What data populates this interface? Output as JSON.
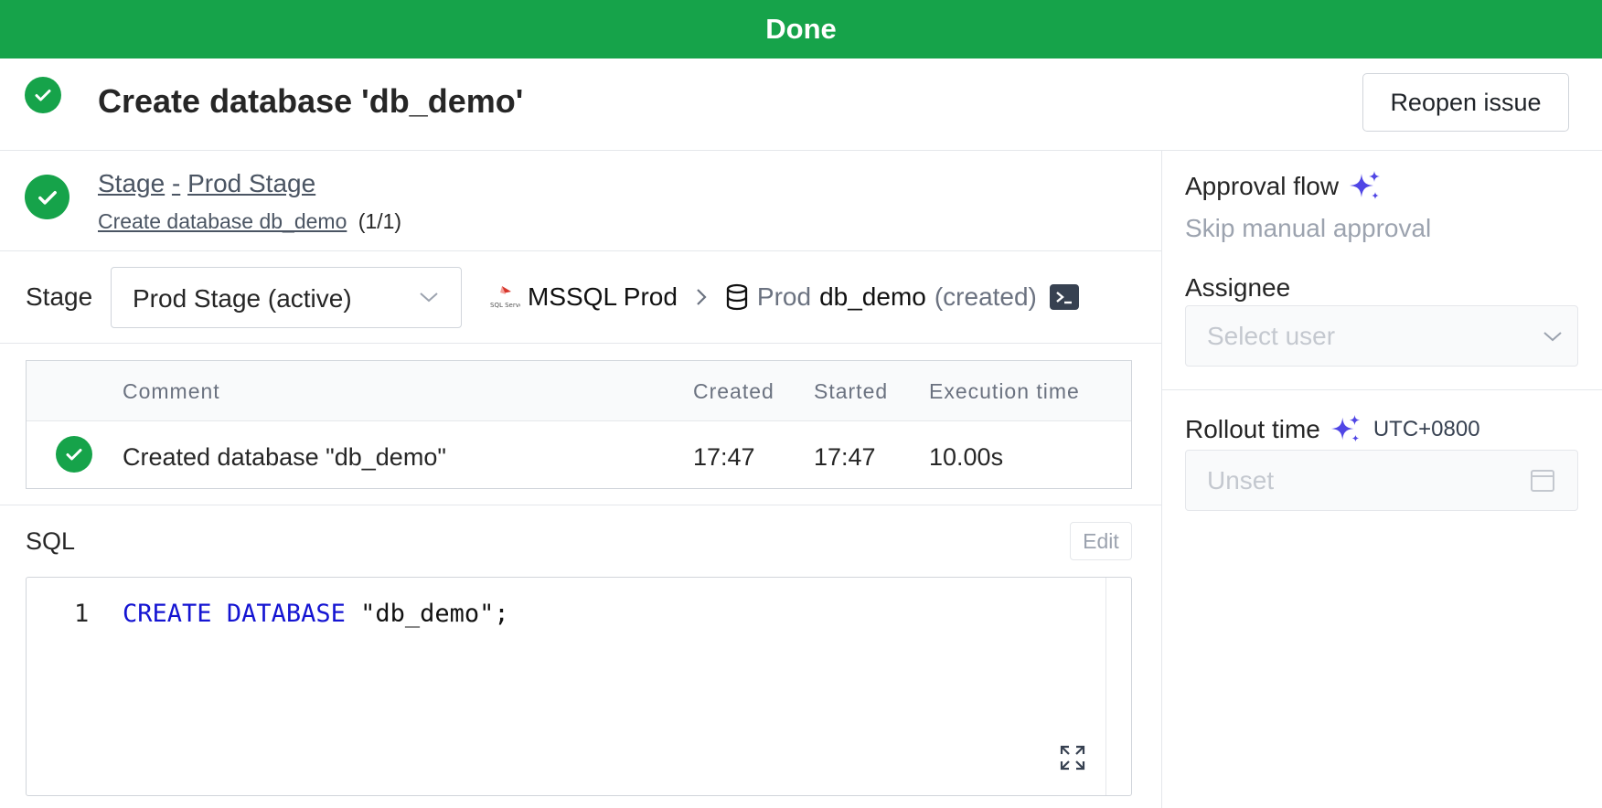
{
  "banner": {
    "status": "Done"
  },
  "issue": {
    "title": "Create database 'db_demo'",
    "reopen_label": "Reopen issue"
  },
  "pipeline": {
    "stage_word": "Stage",
    "stage_separator": "-",
    "stage_name": "Prod Stage",
    "task_link": "Create database db_demo",
    "task_count": "(1/1)"
  },
  "selector": {
    "label": "Stage",
    "selected": "Prod Stage (active)",
    "instance_name": "MSSQL Prod",
    "env_name": "Prod",
    "database_name": "db_demo",
    "database_state": "(created)",
    "engine_icon": "mssql-server-icon"
  },
  "task_runs": {
    "headers": {
      "comment": "Comment",
      "created": "Created",
      "started": "Started",
      "execution_time": "Execution time"
    },
    "rows": [
      {
        "status": "success",
        "comment": "Created database \"db_demo\"",
        "created": "17:47",
        "started": "17:47",
        "execution_time": "10.00s"
      }
    ]
  },
  "sql": {
    "label": "SQL",
    "edit_label": "Edit",
    "line_number": "1",
    "keyword1": "CREATE",
    "keyword2": "DATABASE",
    "rest": " \"db_demo\";"
  },
  "sidebar": {
    "approval_flow_label": "Approval flow",
    "approval_flow_value": "Skip manual approval",
    "assignee_label": "Assignee",
    "assignee_placeholder": "Select user",
    "rollout_time_label": "Rollout time",
    "timezone": "UTC+0800",
    "rollout_placeholder": "Unset"
  },
  "colors": {
    "success": "#16a34a",
    "accent": "#5046e5",
    "sql_keyword": "#1414d2"
  }
}
